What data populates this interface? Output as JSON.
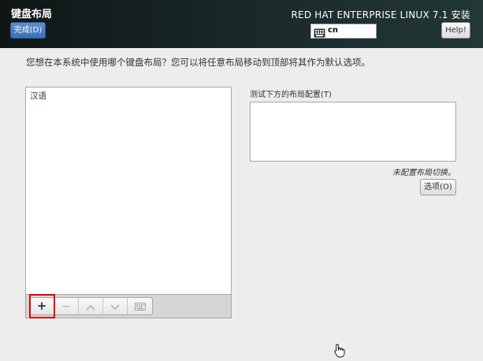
{
  "header": {
    "title": "键盘布局",
    "done_label": "完成(D)",
    "product": "RED HAT ENTERPRISE LINUX 7.1 安装",
    "keyboard_indicator": "cn",
    "help_label": "Help!"
  },
  "instructions": "您想在本系统中使用哪个键盘布局？您可以将任意布局移动到顶部将其作为默认选项。",
  "layouts": {
    "items": [
      "汉语"
    ],
    "toolbar": {
      "add": "+",
      "remove": "−"
    }
  },
  "test": {
    "label": "测试下方的布局配置(T)",
    "value": "",
    "switch_note": "未配置布局切换。",
    "options_label": "选项(O)"
  },
  "icons": {
    "keyboard": "keyboard-icon",
    "up": "chevron-up-icon",
    "down": "chevron-down-icon",
    "preview": "keyboard-preview-icon",
    "cursor": "hand-cursor-icon"
  },
  "colors": {
    "done_button": "#3a6fb5",
    "highlight": "#e00000",
    "header_bg": "#0f1616"
  }
}
